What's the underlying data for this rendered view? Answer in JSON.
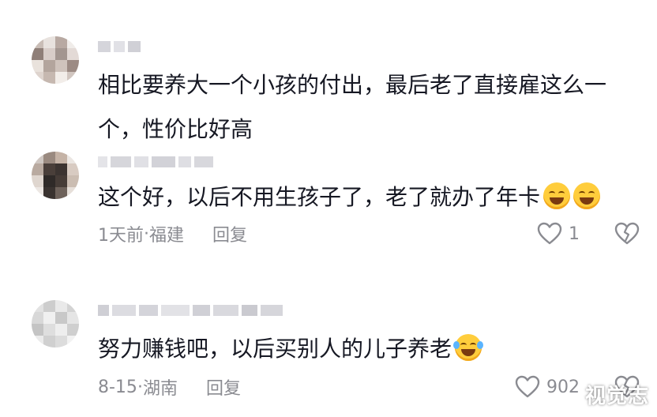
{
  "comments": [
    {
      "lines": [
        "相比要养大一个小孩的付出，最后老了直接雇这么一",
        "个，性价比好高"
      ],
      "emojis": [],
      "time": "",
      "location": "",
      "reply_label": "",
      "likes": ""
    },
    {
      "lines": [
        "这个好，以后不用生孩子了，老了就办了年卡"
      ],
      "emojis": [
        "smile-emoji",
        "smile-emoji"
      ],
      "time": "1天前",
      "location": "福建",
      "reply_label": "回复",
      "likes": "1"
    },
    {
      "lines": [
        "努力赚钱吧，以后买别人的儿子养老"
      ],
      "emojis": [
        "laugh-cry-emoji"
      ],
      "time": "8-15",
      "location": "湖南",
      "reply_label": "回复",
      "likes": "902"
    }
  ],
  "meta_separator": " · ",
  "watermark": "视觉志",
  "colors": {
    "text_primary": "#161823",
    "text_secondary": "#8a8b91",
    "background": "#ffffff"
  }
}
